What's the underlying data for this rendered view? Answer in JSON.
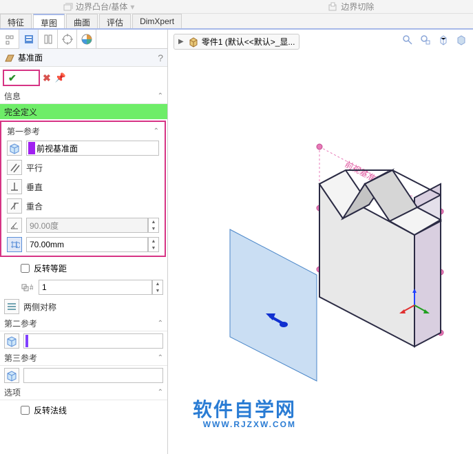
{
  "top_commands": {
    "boss": "边界凸台/基体",
    "cut": "边界切除"
  },
  "tabs": [
    "特征",
    "草图",
    "曲面",
    "评估",
    "DimXpert"
  ],
  "active_tab_index": 1,
  "feature_title": "基准面",
  "help_icon": "?",
  "info_header": "信息",
  "info_value": "完全定义",
  "ref1": {
    "header": "第一参考",
    "selected": "前视基准面",
    "parallel": "平行",
    "perpendicular": "垂直",
    "coincident": "重合",
    "angle": "90.00度",
    "offset": "70.00mm",
    "reverse": "反转等距",
    "count": "1",
    "mirror": "两侧对称"
  },
  "ref2": {
    "header": "第二参考"
  },
  "ref3": {
    "header": "第三参考"
  },
  "options": {
    "header": "选项",
    "flip_normal": "反转法线"
  },
  "breadcrumb": "零件1  (默认<<默认>_显...",
  "plane_label": "前视基准面",
  "watermark": {
    "line1": "软件自学网",
    "line2": "WWW.RJZXW.COM"
  }
}
